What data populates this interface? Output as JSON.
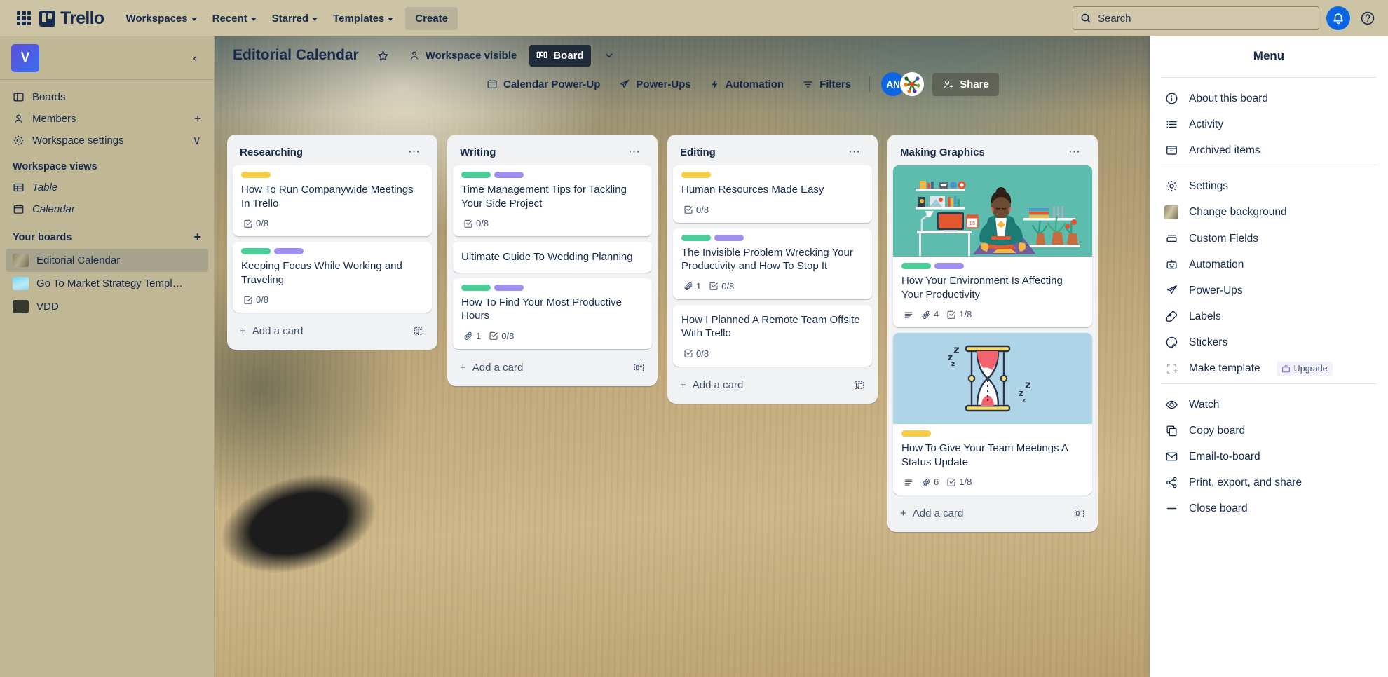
{
  "appbar": {
    "brand": "Trello",
    "nav": [
      {
        "label": "Workspaces"
      },
      {
        "label": "Recent"
      },
      {
        "label": "Starred"
      },
      {
        "label": "Templates"
      }
    ],
    "create_label": "Create",
    "search_placeholder": "Search",
    "icons": {
      "apps_grid": "apps-grid-icon",
      "search": "search-icon",
      "notifications": "notification-bell-icon",
      "help": "help-circle-icon"
    }
  },
  "sidebar": {
    "workspace_initial": "V",
    "collapse_label": "‹",
    "items": [
      {
        "label": "Boards",
        "icon": "board-icon",
        "trail": ""
      },
      {
        "label": "Members",
        "icon": "members-icon",
        "trail": "+"
      },
      {
        "label": "Workspace settings",
        "icon": "gear-icon",
        "trail": "∨"
      }
    ],
    "views_heading": "Workspace views",
    "views": [
      {
        "label": "Table",
        "icon": "table-icon"
      },
      {
        "label": "Calendar",
        "icon": "calendar-icon"
      }
    ],
    "boards_heading": "Your boards",
    "boards_add": "+",
    "boards": [
      {
        "label": "Editorial Calendar",
        "thumb": "tb-edit",
        "active": true
      },
      {
        "label": "Go To Market Strategy Templ…",
        "thumb": "tb-gtm",
        "active": false
      },
      {
        "label": "VDD",
        "thumb": "tb-vdd",
        "active": false
      }
    ]
  },
  "board_header": {
    "title": "Editorial Calendar",
    "star_icon": "star-icon",
    "visibility": "Workspace visible",
    "view_label": "Board",
    "view_chevron": "chevron-down-icon",
    "toolbar": [
      {
        "label": "Calendar Power-Up",
        "icon": "calendar-icon"
      },
      {
        "label": "Power-Ups",
        "icon": "rocket-icon"
      },
      {
        "label": "Automation",
        "icon": "bolt-icon"
      },
      {
        "label": "Filters",
        "icon": "filter-icon"
      }
    ],
    "avatars": [
      {
        "initials": "AN",
        "type": "initials"
      },
      {
        "initials": "",
        "type": "logo"
      }
    ],
    "share_label": "Share"
  },
  "lists": [
    {
      "title": "Researching",
      "add_card_label": "Add a card",
      "cards": [
        {
          "title": "How To Run Companywide Meetings In Trello",
          "labels": [
            "#f5cd47"
          ],
          "badges": [
            {
              "icon": "checklist-icon",
              "text": "0/8"
            }
          ]
        },
        {
          "title": "Keeping Focus While Working and Traveling",
          "labels": [
            "#4bce97",
            "#9f8fef"
          ],
          "badges": [
            {
              "icon": "checklist-icon",
              "text": "0/8"
            }
          ]
        }
      ]
    },
    {
      "title": "Writing",
      "add_card_label": "Add a card",
      "cards": [
        {
          "title": "Time Management Tips for Tackling Your Side Project",
          "labels": [
            "#4bce97",
            "#9f8fef"
          ],
          "badges": [
            {
              "icon": "checklist-icon",
              "text": "0/8"
            }
          ]
        },
        {
          "title": "Ultimate Guide To Wedding Planning",
          "labels": [],
          "badges": []
        },
        {
          "title": "How To Find Your Most Productive Hours",
          "labels": [
            "#4bce97",
            "#9f8fef"
          ],
          "badges": [
            {
              "icon": "attachment-icon",
              "text": "1"
            },
            {
              "icon": "checklist-icon",
              "text": "0/8"
            }
          ]
        }
      ]
    },
    {
      "title": "Editing",
      "add_card_label": "Add a card",
      "cards": [
        {
          "title": "Human Resources Made Easy",
          "labels": [
            "#f5cd47"
          ],
          "badges": [
            {
              "icon": "checklist-icon",
              "text": "0/8"
            }
          ]
        },
        {
          "title": "The Invisible Problem Wrecking Your Productivity and How To Stop It",
          "labels": [
            "#4bce97",
            "#9f8fef"
          ],
          "badges": [
            {
              "icon": "attachment-icon",
              "text": "1"
            },
            {
              "icon": "checklist-icon",
              "text": "0/8"
            }
          ]
        },
        {
          "title": "How I Planned A Remote Team Offsite With Trello",
          "labels": [],
          "badges": [
            {
              "icon": "checklist-icon",
              "text": "0/8"
            }
          ]
        }
      ]
    },
    {
      "title": "Making Graphics",
      "add_card_label": "Add a card",
      "cards": [
        {
          "title": "How Your Environment Is Affecting Your Productivity",
          "cover": "meditating-person-desk-illustration",
          "cover_style": "cover-teal",
          "labels": [
            "#4bce97",
            "#9f8fef"
          ],
          "badges": [
            {
              "icon": "description-icon",
              "text": ""
            },
            {
              "icon": "attachment-icon",
              "text": "4"
            },
            {
              "icon": "checklist-icon",
              "text": "1/8"
            }
          ]
        },
        {
          "title": "How To Give Your Team Meetings A Status Update",
          "cover": "sleeping-hourglass-illustration",
          "cover_style": "cover-blue",
          "labels": [
            "#f5cd47"
          ],
          "badges": [
            {
              "icon": "description-icon",
              "text": ""
            },
            {
              "icon": "attachment-icon",
              "text": "6"
            },
            {
              "icon": "checklist-icon",
              "text": "1/8"
            }
          ]
        }
      ]
    }
  ],
  "menu": {
    "title": "Menu",
    "groups": [
      [
        {
          "label": "About this board",
          "icon": "info-icon"
        },
        {
          "label": "Activity",
          "icon": "activity-list-icon"
        },
        {
          "label": "Archived items",
          "icon": "archive-icon"
        }
      ],
      [
        {
          "label": "Settings",
          "icon": "gear-icon"
        },
        {
          "label": "Change background",
          "icon": "background-thumbnail-icon"
        },
        {
          "label": "Custom Fields",
          "icon": "custom-fields-icon"
        },
        {
          "label": "Automation",
          "icon": "robot-icon"
        },
        {
          "label": "Power-Ups",
          "icon": "rocket-icon"
        },
        {
          "label": "Labels",
          "icon": "label-tag-icon"
        },
        {
          "label": "Stickers",
          "icon": "sticker-icon"
        },
        {
          "label": "Make template",
          "icon": "template-icon",
          "badge": "Upgrade",
          "badge_icon": "briefcase-icon",
          "muted": true
        }
      ],
      [
        {
          "label": "Watch",
          "icon": "eye-icon"
        },
        {
          "label": "Copy board",
          "icon": "copy-icon"
        },
        {
          "label": "Email-to-board",
          "icon": "envelope-icon"
        },
        {
          "label": "Print, export, and share",
          "icon": "share-nodes-icon"
        },
        {
          "label": "Close board",
          "icon": "minus-icon"
        }
      ]
    ]
  }
}
